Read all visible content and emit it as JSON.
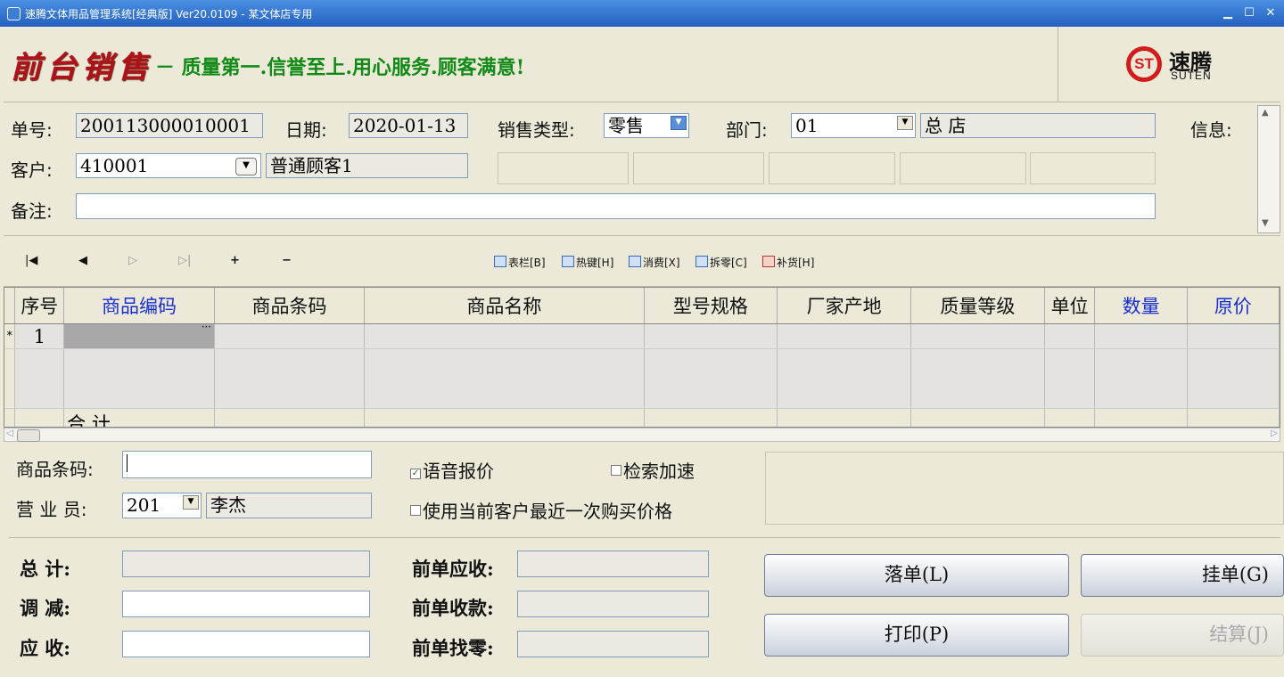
{
  "window": {
    "title": "速腾文体用品管理系统[经典版] Ver20.0109  -  某文体店专用",
    "minimize": "▁",
    "maximize": "☐",
    "close": "✕"
  },
  "banner": {
    "title": "前台销售",
    "slogan": "－ 质量第一.信誉至上.用心服务.顾客满意!",
    "logo_mark": "ST",
    "logo_name": "速腾",
    "logo_en": "SUTEN"
  },
  "form": {
    "order_no_label": "单号:",
    "order_no": "200113000010001",
    "date_label": "日期:",
    "date": "2020-01-13",
    "sale_type_label": "销售类型:",
    "sale_type": "零售",
    "dept_label": "部门:",
    "dept_code": "01",
    "dept_name": "总  店",
    "info_label": "信息:",
    "customer_label": "客户:",
    "customer_code": "410001",
    "customer_name": "普通顾客1",
    "remark_label": "备注:",
    "remark": ""
  },
  "toolbar": {
    "columns": "表栏[B]",
    "hotkeys": "热键[H]",
    "consume": "消费[X]",
    "split": "拆零[C]",
    "restock": "补货[H]"
  },
  "grid": {
    "columns": [
      "序号",
      "商品编码",
      "商品条码",
      "商品名称",
      "型号规格",
      "厂家产地",
      "质量等级",
      "单位",
      "数量",
      "原价"
    ],
    "row_marker": "*",
    "row_no": "1",
    "cell_ellipsis": "⋯",
    "total_label": "合  计"
  },
  "scan": {
    "barcode_label": "商品条码:",
    "barcode_value": "",
    "clerk_label": "营 业 员:",
    "clerk_code": "201",
    "clerk_name": "李杰",
    "voice_price_label": "语音报价",
    "voice_price_checked": true,
    "search_speedup_label": "检索加速",
    "search_speedup_checked": false,
    "last_price_label": "使用当前客户最近一次购买价格",
    "last_price_checked": false
  },
  "totals": {
    "total_label": "总    计:",
    "adjust_label": "调    减:",
    "receivable_label": "应    收:",
    "prev_receivable_label": "前单应收:",
    "prev_paid_label": "前单收款:",
    "prev_change_label": "前单找零:"
  },
  "buttons": {
    "place_order": "落单(L)",
    "hold_order": "挂单(G)",
    "print": "打印(P)",
    "settle": "结算(J)"
  }
}
